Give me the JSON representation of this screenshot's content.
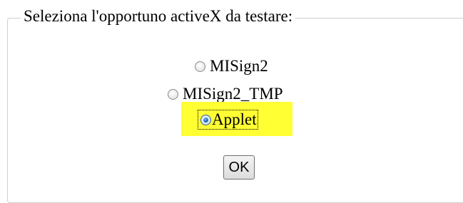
{
  "form": {
    "legend": "Seleziona l'opportuno activeX da testare:",
    "options": [
      {
        "label": "MISign2",
        "checked": false
      },
      {
        "label": "MISign2_TMP",
        "checked": false
      },
      {
        "label": "Applet",
        "checked": true
      }
    ],
    "ok_label": "OK",
    "highlight_color": "#ffff33"
  }
}
